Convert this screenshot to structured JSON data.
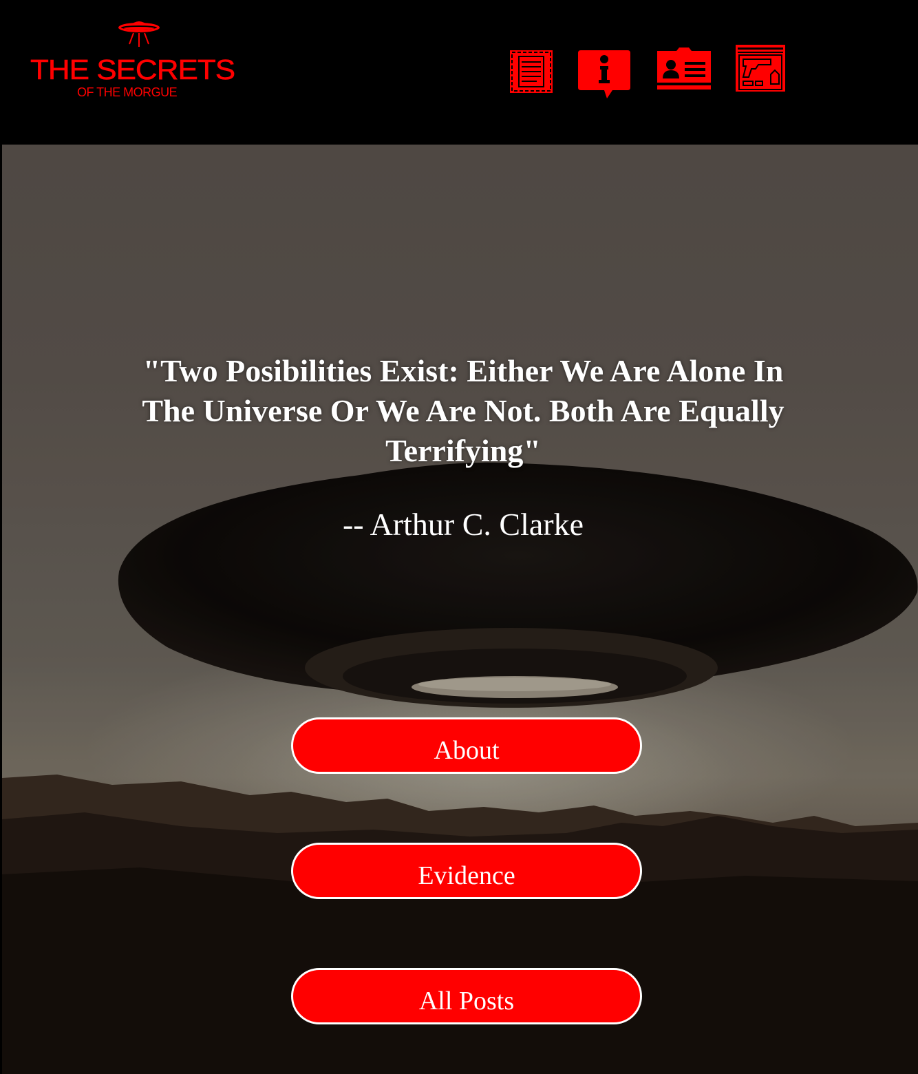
{
  "header": {
    "logo": {
      "title": "THE SECRETS",
      "subtitle": "OF THE MORGUE",
      "icon": "ufo-icon"
    },
    "nav_icons": [
      {
        "name": "case-file-icon"
      },
      {
        "name": "info-icon"
      },
      {
        "name": "contact-card-icon"
      },
      {
        "name": "evidence-gun-icon"
      }
    ]
  },
  "hero": {
    "quote": "\"Two Posibilities Exist: Either We Are Alone In The Universe Or We Are Not. Both Are Equally Terrifying\"",
    "author": "-- Arthur C. Clarke",
    "buttons": {
      "about": "About",
      "evidence": "Evidence",
      "all_posts": "All Posts"
    }
  },
  "colors": {
    "accent": "#ff0000",
    "header_bg": "#000000",
    "button_border": "#ffffff",
    "text": "#ffffff"
  }
}
